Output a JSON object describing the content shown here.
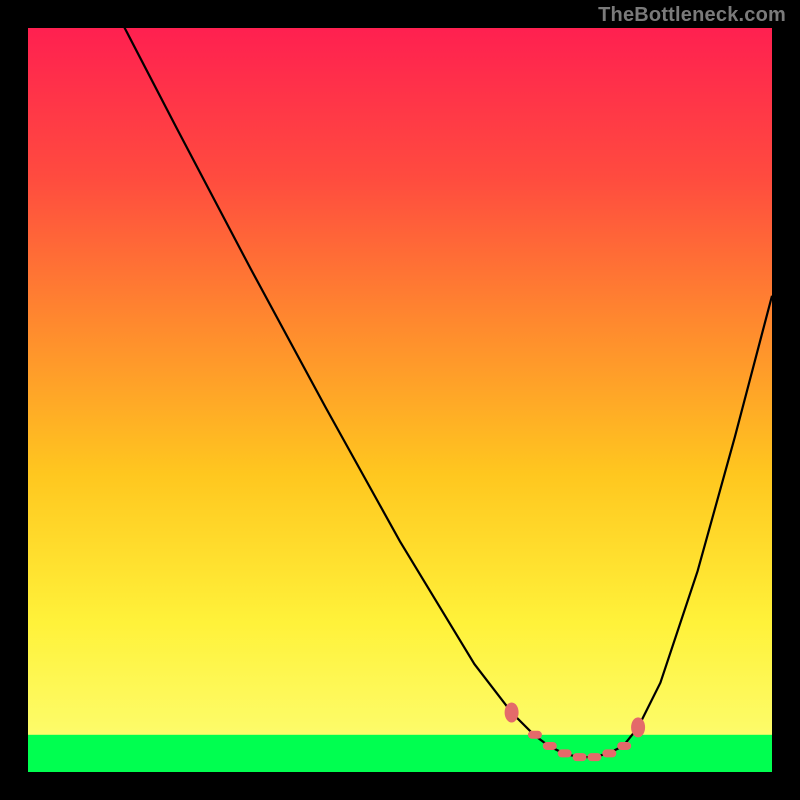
{
  "watermark": "TheBottleneck.com",
  "colors": {
    "gradient_top": "#ff2050",
    "gradient_mid1": "#ff4b3f",
    "gradient_mid2": "#ff8a2e",
    "gradient_mid3": "#ffc71f",
    "gradient_mid4": "#fff23a",
    "gradient_bottom": "#fcff7a",
    "green": "#00ff50",
    "curve": "#000000",
    "marker": "#e46a6a",
    "frame": "#000000"
  },
  "chart_data": {
    "type": "line",
    "title": "",
    "xlabel": "",
    "ylabel": "",
    "xlim": [
      0,
      100
    ],
    "ylim": [
      0,
      100
    ],
    "x": [
      0,
      5,
      10,
      13,
      20,
      30,
      40,
      50,
      60,
      65,
      68,
      70,
      72,
      74,
      76,
      78,
      80,
      82,
      85,
      90,
      95,
      100
    ],
    "values": [
      125,
      116,
      106,
      100,
      86.5,
      67.5,
      49,
      31,
      14.5,
      8,
      5,
      3.5,
      2.5,
      2,
      2,
      2.5,
      3.5,
      6,
      12,
      27,
      45,
      64
    ],
    "optimal_range_x": [
      65,
      82
    ],
    "optimal_markers_x": [
      65,
      68,
      70,
      72,
      74,
      76,
      78,
      80,
      82
    ],
    "green_band_y": [
      0,
      5
    ],
    "annotations": []
  }
}
